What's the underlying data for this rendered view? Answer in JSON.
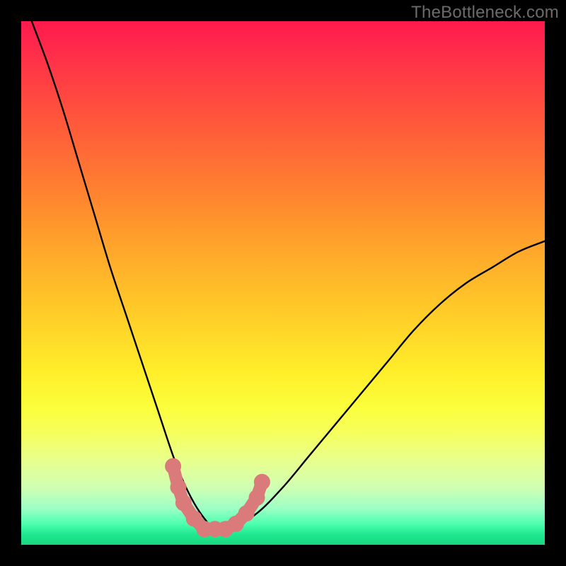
{
  "watermark": "TheBottleneck.com",
  "chart_data": {
    "type": "line",
    "title": "",
    "xlabel": "",
    "ylabel": "",
    "xlim": [
      0,
      100
    ],
    "ylim": [
      0,
      100
    ],
    "grid": false,
    "legend": false,
    "background": {
      "type": "vertical-gradient",
      "stops": [
        {
          "pos": 0.0,
          "color": "#ff1a4d"
        },
        {
          "pos": 0.15,
          "color": "#ff4a3f"
        },
        {
          "pos": 0.35,
          "color": "#ff8a2e"
        },
        {
          "pos": 0.57,
          "color": "#ffd028"
        },
        {
          "pos": 0.74,
          "color": "#fbff3d"
        },
        {
          "pos": 0.89,
          "color": "#d0ffb2"
        },
        {
          "pos": 0.96,
          "color": "#4dffb0"
        },
        {
          "pos": 1.0,
          "color": "#16d77f"
        }
      ]
    },
    "series": [
      {
        "name": "bottleneck-curve",
        "x": [
          2,
          5,
          8,
          11,
          14,
          17,
          20,
          23,
          26,
          29,
          31,
          33,
          35,
          37,
          40,
          45,
          50,
          55,
          60,
          65,
          70,
          75,
          80,
          85,
          90,
          95,
          100
        ],
        "y": [
          100,
          92,
          83,
          73,
          63,
          53,
          44,
          35,
          26,
          17,
          12,
          8,
          5,
          3,
          3,
          6,
          11,
          17,
          23,
          29,
          35,
          41,
          46,
          50,
          53,
          56,
          58
        ]
      }
    ],
    "markers": {
      "name": "highlight-band",
      "color": "#db7a7a",
      "points": [
        {
          "x": 29,
          "y": 15
        },
        {
          "x": 30,
          "y": 11
        },
        {
          "x": 31,
          "y": 8
        },
        {
          "x": 33,
          "y": 5
        },
        {
          "x": 35,
          "y": 3
        },
        {
          "x": 37,
          "y": 3
        },
        {
          "x": 39,
          "y": 3
        },
        {
          "x": 41,
          "y": 4
        },
        {
          "x": 43,
          "y": 6
        },
        {
          "x": 45,
          "y": 9
        },
        {
          "x": 46,
          "y": 12
        }
      ]
    }
  }
}
